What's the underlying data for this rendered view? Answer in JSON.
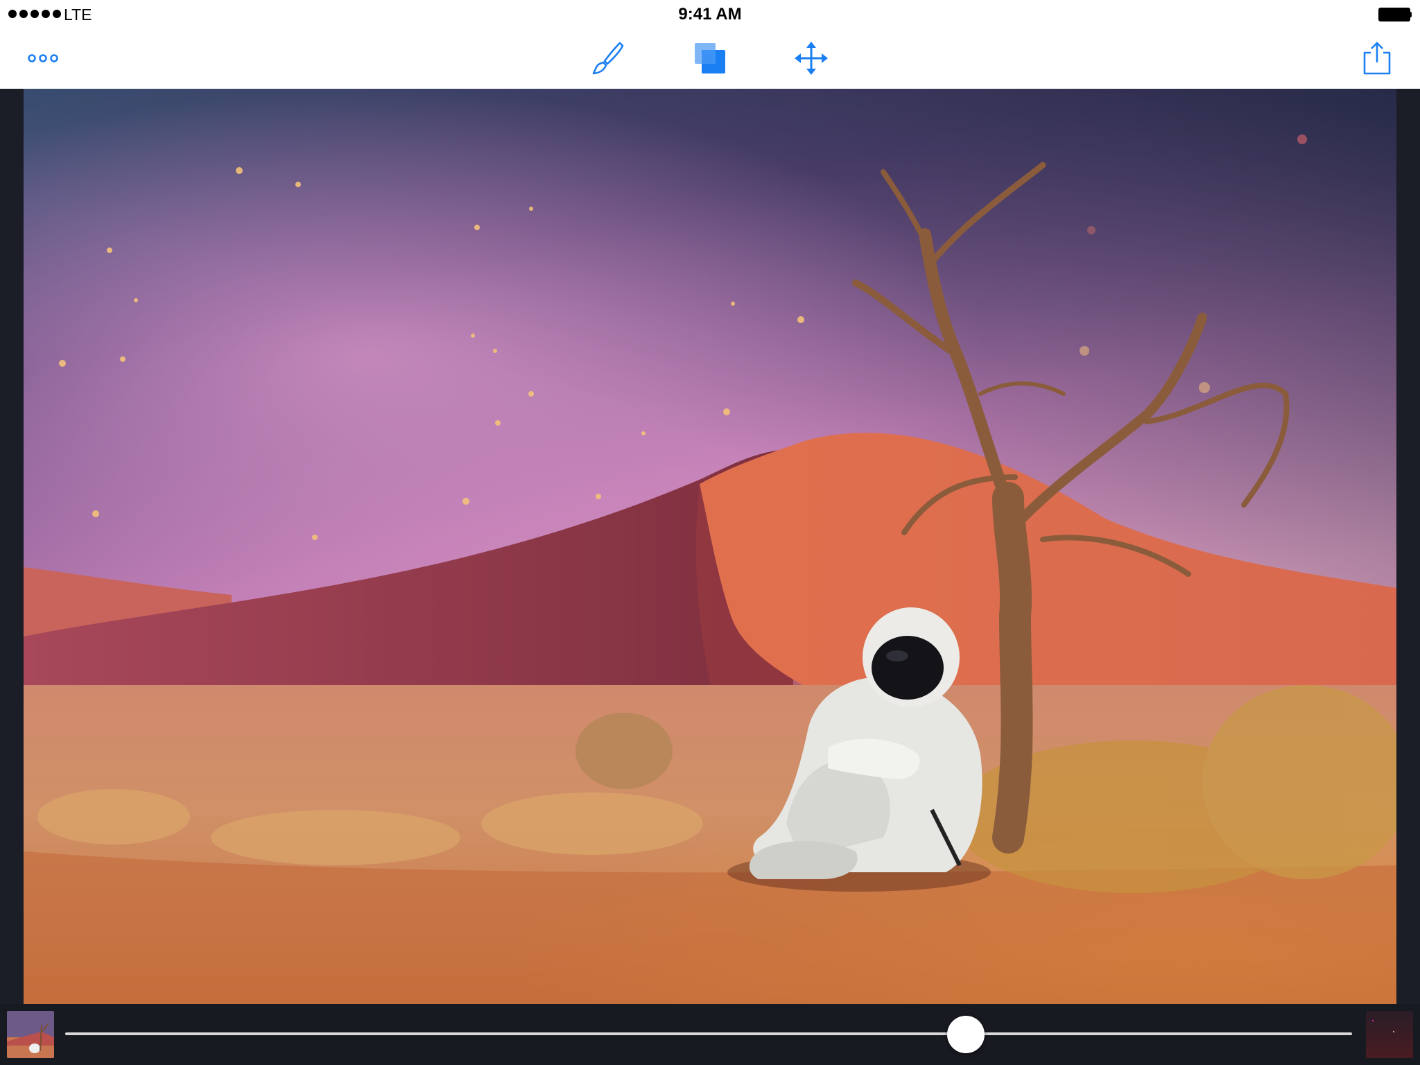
{
  "status_bar": {
    "carrier": "LTE",
    "time": "9:41 AM",
    "signal_bars": 5
  },
  "toolbar": {
    "more_icon": "more-icon",
    "brush_icon": "brush-icon",
    "layers_icon": "layers-icon",
    "move_icon": "move-icon",
    "share_icon": "share-icon",
    "accent_color": "#1a7ff2"
  },
  "canvas": {
    "image_description_icon": "photo-canvas"
  },
  "bottom_bar": {
    "slider_value": 0.7
  }
}
